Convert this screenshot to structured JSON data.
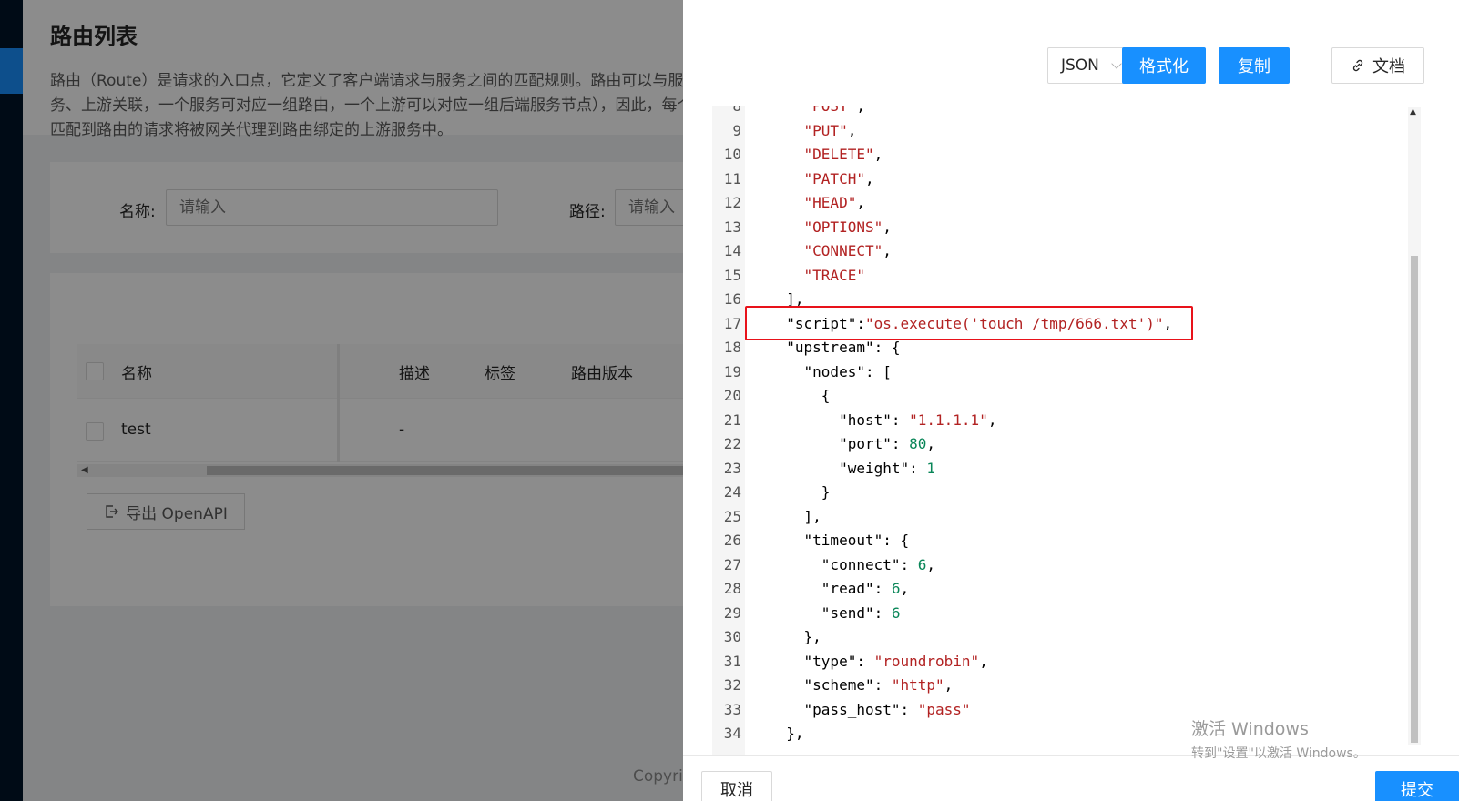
{
  "page": {
    "title": "路由列表",
    "description": "路由（Route）是请求的入口点，它定义了客户端请求与服务之间的匹配规则。路由可以与服务、上游关联，一个服务可对应一组路由，一个上游可以对应一组后端服务节点），因此，每个匹配到路由的请求将被网关代理到路由绑定的上游服务中。",
    "filter": {
      "name_label": "名称:",
      "name_placeholder": "请输入",
      "path_label": "路径:",
      "path_placeholder": "请输入"
    },
    "table": {
      "columns": [
        "名称",
        "描述",
        "标签",
        "路由版本"
      ],
      "rows": [
        {
          "name": "test",
          "desc": "-"
        }
      ]
    },
    "export_label": "导出 OpenAPI",
    "footer_copyright": "Copyri"
  },
  "drawer": {
    "format_select": "JSON",
    "format_button": "格式化",
    "copy_button": "复制",
    "doc_button": "文档",
    "cancel_button": "取消",
    "submit_button": "提交"
  },
  "editor": {
    "lines": [
      {
        "n": "8",
        "indent": 4,
        "tokens": [
          [
            "s",
            "\"POST\""
          ],
          [
            "p",
            ","
          ]
        ]
      },
      {
        "n": "9",
        "indent": 4,
        "tokens": [
          [
            "s",
            "\"PUT\""
          ],
          [
            "p",
            ","
          ]
        ]
      },
      {
        "n": "10",
        "indent": 4,
        "tokens": [
          [
            "s",
            "\"DELETE\""
          ],
          [
            "p",
            ","
          ]
        ]
      },
      {
        "n": "11",
        "indent": 4,
        "tokens": [
          [
            "s",
            "\"PATCH\""
          ],
          [
            "p",
            ","
          ]
        ]
      },
      {
        "n": "12",
        "indent": 4,
        "tokens": [
          [
            "s",
            "\"HEAD\""
          ],
          [
            "p",
            ","
          ]
        ]
      },
      {
        "n": "13",
        "indent": 4,
        "tokens": [
          [
            "s",
            "\"OPTIONS\""
          ],
          [
            "p",
            ","
          ]
        ]
      },
      {
        "n": "14",
        "indent": 4,
        "tokens": [
          [
            "s",
            "\"CONNECT\""
          ],
          [
            "p",
            ","
          ]
        ]
      },
      {
        "n": "15",
        "indent": 4,
        "tokens": [
          [
            "s",
            "\"TRACE\""
          ]
        ]
      },
      {
        "n": "16",
        "indent": 2,
        "tokens": [
          [
            "p",
            "],"
          ]
        ]
      },
      {
        "n": "17",
        "indent": 2,
        "tokens": [
          [
            "k",
            "\"script\""
          ],
          [
            "p",
            ":"
          ],
          [
            "s",
            "\"os.execute('touch /tmp/666.txt')\""
          ],
          [
            "p",
            ","
          ]
        ]
      },
      {
        "n": "18",
        "indent": 2,
        "tokens": [
          [
            "k",
            "\"upstream\""
          ],
          [
            "p",
            ": {"
          ]
        ]
      },
      {
        "n": "19",
        "indent": 4,
        "tokens": [
          [
            "k",
            "\"nodes\""
          ],
          [
            "p",
            ": ["
          ]
        ]
      },
      {
        "n": "20",
        "indent": 6,
        "tokens": [
          [
            "p",
            "{"
          ]
        ]
      },
      {
        "n": "21",
        "indent": 8,
        "tokens": [
          [
            "k",
            "\"host\""
          ],
          [
            "p",
            ": "
          ],
          [
            "s",
            "\"1.1.1.1\""
          ],
          [
            "p",
            ","
          ]
        ]
      },
      {
        "n": "22",
        "indent": 8,
        "tokens": [
          [
            "k",
            "\"port\""
          ],
          [
            "p",
            ": "
          ],
          [
            "n",
            "80"
          ],
          [
            "p",
            ","
          ]
        ]
      },
      {
        "n": "23",
        "indent": 8,
        "tokens": [
          [
            "k",
            "\"weight\""
          ],
          [
            "p",
            ": "
          ],
          [
            "n",
            "1"
          ]
        ]
      },
      {
        "n": "24",
        "indent": 6,
        "tokens": [
          [
            "p",
            "}"
          ]
        ]
      },
      {
        "n": "25",
        "indent": 4,
        "tokens": [
          [
            "p",
            "],"
          ]
        ]
      },
      {
        "n": "26",
        "indent": 4,
        "tokens": [
          [
            "k",
            "\"timeout\""
          ],
          [
            "p",
            ": {"
          ]
        ]
      },
      {
        "n": "27",
        "indent": 6,
        "tokens": [
          [
            "k",
            "\"connect\""
          ],
          [
            "p",
            ": "
          ],
          [
            "n",
            "6"
          ],
          [
            "p",
            ","
          ]
        ]
      },
      {
        "n": "28",
        "indent": 6,
        "tokens": [
          [
            "k",
            "\"read\""
          ],
          [
            "p",
            ": "
          ],
          [
            "n",
            "6"
          ],
          [
            "p",
            ","
          ]
        ]
      },
      {
        "n": "29",
        "indent": 6,
        "tokens": [
          [
            "k",
            "\"send\""
          ],
          [
            "p",
            ": "
          ],
          [
            "n",
            "6"
          ]
        ]
      },
      {
        "n": "30",
        "indent": 4,
        "tokens": [
          [
            "p",
            "},"
          ]
        ]
      },
      {
        "n": "31",
        "indent": 4,
        "tokens": [
          [
            "k",
            "\"type\""
          ],
          [
            "p",
            ": "
          ],
          [
            "s",
            "\"roundrobin\""
          ],
          [
            "p",
            ","
          ]
        ]
      },
      {
        "n": "32",
        "indent": 4,
        "tokens": [
          [
            "k",
            "\"scheme\""
          ],
          [
            "p",
            ": "
          ],
          [
            "s",
            "\"http\""
          ],
          [
            "p",
            ","
          ]
        ]
      },
      {
        "n": "33",
        "indent": 4,
        "tokens": [
          [
            "k",
            "\"pass_host\""
          ],
          [
            "p",
            ": "
          ],
          [
            "s",
            "\"pass\""
          ]
        ]
      },
      {
        "n": "34",
        "indent": 2,
        "tokens": [
          [
            "p",
            "},"
          ]
        ]
      }
    ]
  },
  "watermark": {
    "title": "激活 Windows",
    "subtitle": "转到\"设置\"以激活 Windows。"
  },
  "colors": {
    "primary": "#1890ff",
    "nav_bg": "#001529",
    "highlight_border": "#e8121a",
    "string": "#b22222",
    "number": "#098658"
  }
}
